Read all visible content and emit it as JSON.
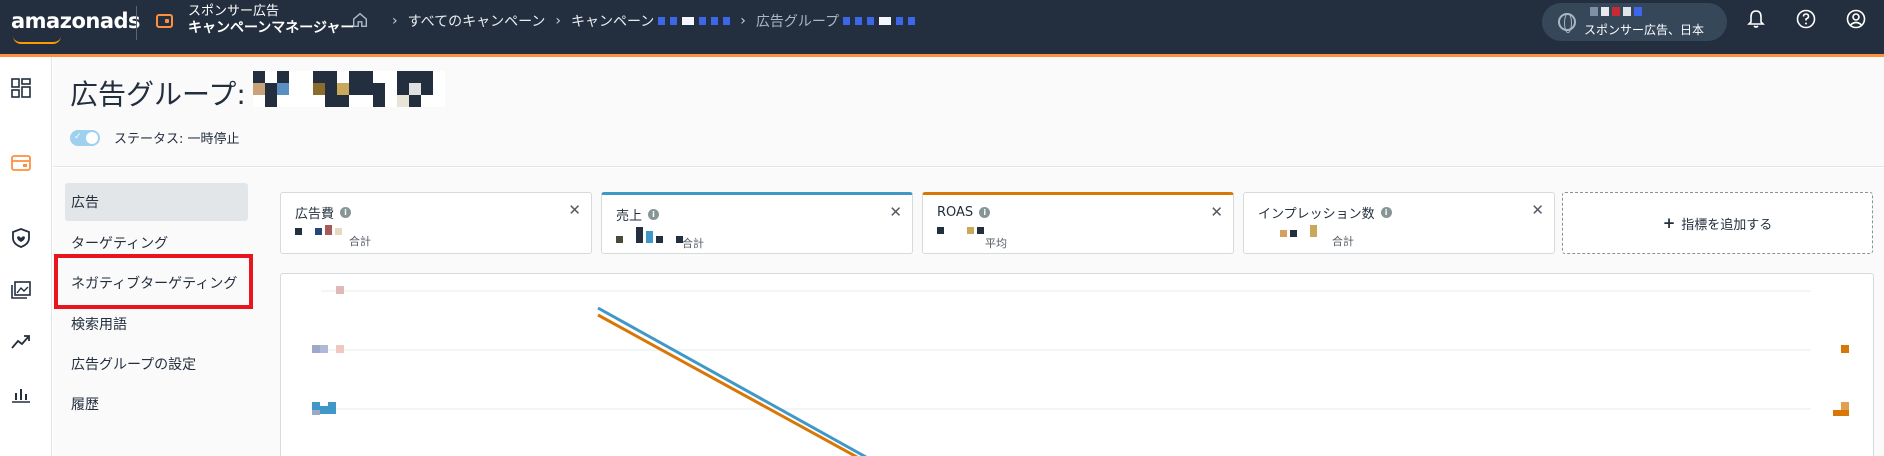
{
  "topbar": {
    "logo": "amazonads",
    "product_line1": "スポンサー広告",
    "product_line2": "キャンペーンマネージャー",
    "breadcrumb": [
      "すべてのキャンペーン",
      "キャンペーン",
      "広告グループ"
    ],
    "account_label": "スポンサー広告、日本",
    "icons": [
      "home-icon",
      "globe-icon",
      "bell-icon",
      "help-icon",
      "account-icon"
    ]
  },
  "rail": {
    "icons": [
      "dashboard-icon",
      "campaign-icon",
      "brand-shield-icon",
      "media-icon",
      "trend-icon",
      "bar-chart-icon"
    ]
  },
  "header": {
    "title": "広告グループ:",
    "status_label": "ステータス: 一時停止"
  },
  "subnav": {
    "items": [
      "広告",
      "ターゲティング",
      "ネガティブターゲティング",
      "検索用語",
      "広告グループの設定",
      "履歴"
    ],
    "active_index": 0,
    "highlighted_index": 2
  },
  "metrics": [
    {
      "name": "広告費",
      "aggregate": "合計",
      "accent": "none"
    },
    {
      "name": "売上",
      "aggregate": "合計",
      "accent": "#3f98c7"
    },
    {
      "name": "ROAS",
      "aggregate": "平均",
      "accent": "#d97706"
    },
    {
      "name": "インプレッション数",
      "aggregate": "合計",
      "accent": "none"
    }
  ],
  "add_metric_label": "指標を追加する",
  "colors": {
    "topbar": "#232f3e",
    "accent_orange": "#ff8f3f",
    "series_blue": "#3f98c7",
    "series_orange": "#d97706",
    "highlight_red": "#e8141e"
  }
}
